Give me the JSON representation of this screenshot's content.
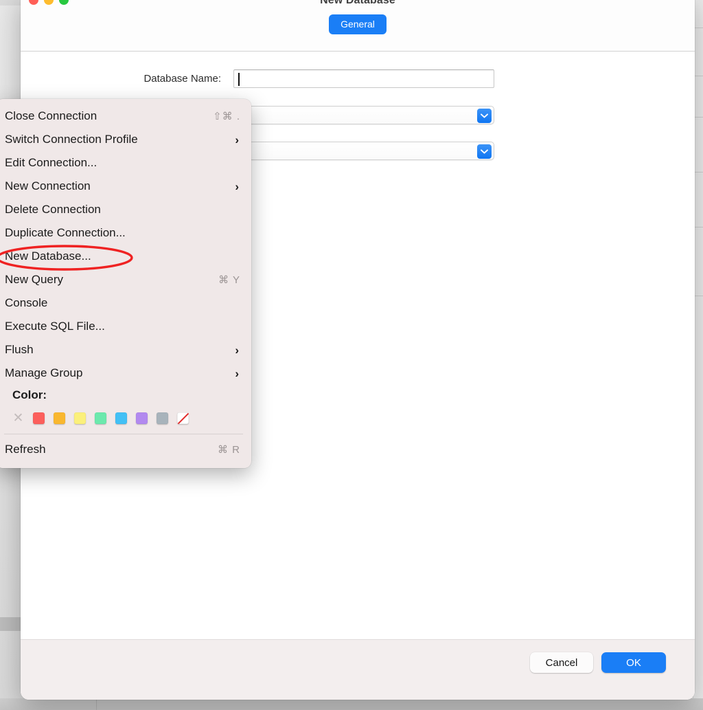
{
  "dialog": {
    "title": "New Database",
    "window_controls": [
      {
        "name": "close",
        "color": "#ff5f57"
      },
      {
        "name": "minimize",
        "color": "#febc2e"
      },
      {
        "name": "zoom",
        "color": "#28c840"
      }
    ],
    "tabs": [
      {
        "id": "general",
        "label": "General",
        "selected": true,
        "accent": "#1a7ef6"
      }
    ],
    "form": {
      "rows": [
        {
          "label": "Database Name:",
          "type": "text",
          "value": "",
          "placeholder": "",
          "focused": true
        },
        {
          "label": "",
          "type": "popup",
          "value": "",
          "arrow_icon": "chevron-down-icon"
        },
        {
          "label": "",
          "type": "popup",
          "value": "",
          "arrow_icon": "chevron-down-icon"
        }
      ]
    },
    "footer": {
      "cancel_label": "Cancel",
      "ok_label": "OK",
      "ok_accent": "#1a7ef6"
    }
  },
  "context_menu": {
    "items": [
      {
        "label": "Close Connection",
        "shortcut": "⇧⌘ .",
        "submenu": false
      },
      {
        "label": "Switch Connection Profile",
        "shortcut": "",
        "submenu": true
      },
      {
        "label": "Edit Connection...",
        "shortcut": "",
        "submenu": false
      },
      {
        "label": "New Connection",
        "shortcut": "",
        "submenu": true
      },
      {
        "label": "Delete Connection",
        "shortcut": "",
        "submenu": false
      },
      {
        "label": "Duplicate Connection...",
        "shortcut": "",
        "submenu": false
      },
      {
        "label": "New Database...",
        "shortcut": "",
        "submenu": false,
        "highlighted": true
      },
      {
        "label": "New Query",
        "shortcut": "⌘ Y",
        "submenu": false
      },
      {
        "label": "Console",
        "shortcut": "",
        "submenu": false
      },
      {
        "label": "Execute SQL File...",
        "shortcut": "",
        "submenu": false
      },
      {
        "label": "Flush",
        "shortcut": "",
        "submenu": true
      },
      {
        "label": "Manage Group",
        "shortcut": "",
        "submenu": true
      }
    ],
    "color_section": {
      "label": "Color:",
      "swatches": [
        {
          "name": "none",
          "color": "none",
          "icon": "clear-x-icon"
        },
        {
          "name": "red",
          "color": "#fc5f5c"
        },
        {
          "name": "orange",
          "color": "#f9b72f"
        },
        {
          "name": "yellow",
          "color": "#fbf07b"
        },
        {
          "name": "green",
          "color": "#6ce9ad"
        },
        {
          "name": "blue",
          "color": "#43c0f5"
        },
        {
          "name": "purple",
          "color": "#b289ef"
        },
        {
          "name": "gray",
          "color": "#a8b3bb"
        },
        {
          "name": "custom",
          "color": "#ffffff",
          "icon": "custom-color-icon"
        }
      ]
    },
    "footer_items": [
      {
        "label": "Refresh",
        "shortcut": "⌘ R",
        "submenu": false
      }
    ]
  },
  "annotation": {
    "type": "ellipse",
    "color": "#ef2222",
    "targets": "New Database..."
  }
}
